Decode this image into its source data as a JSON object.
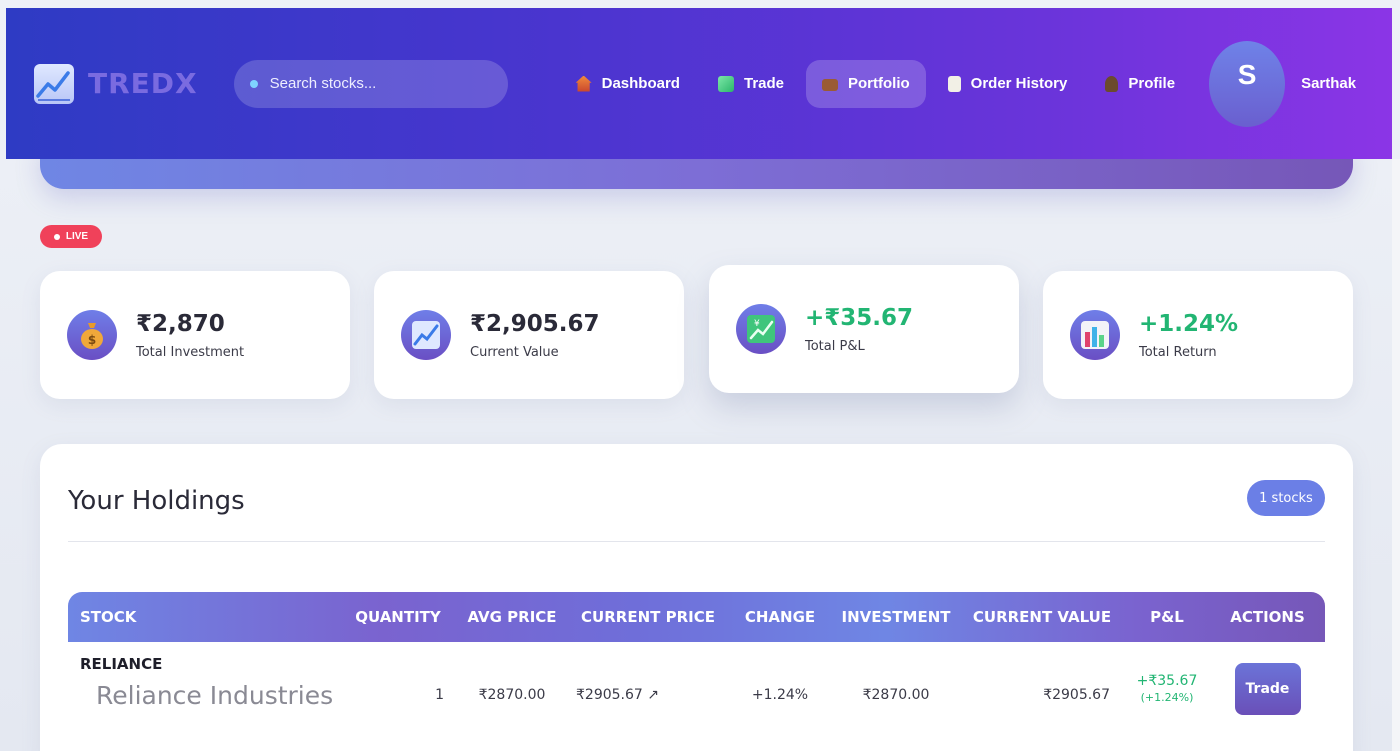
{
  "brand": {
    "name": "TREDX",
    "logo_icon": "chart-trend-icon"
  },
  "search": {
    "placeholder": "Search stocks..."
  },
  "nav": {
    "items": [
      {
        "label": "Dashboard",
        "icon": "house-icon",
        "active": false
      },
      {
        "label": "Trade",
        "icon": "chart-icon",
        "active": false
      },
      {
        "label": "Portfolio",
        "icon": "briefcase-icon",
        "active": true
      },
      {
        "label": "Order History",
        "icon": "clipboard-icon",
        "active": false
      },
      {
        "label": "Profile",
        "icon": "person-icon",
        "active": false
      }
    ]
  },
  "user": {
    "initial": "S",
    "name": "Sarthak"
  },
  "live_badge": "LIVE",
  "stats": [
    {
      "value": "₹2,870",
      "label": "Total Investment",
      "icon": "money-bag-icon",
      "positive": false
    },
    {
      "value": "₹2,905.67",
      "label": "Current Value",
      "icon": "trend-chart-icon",
      "positive": false
    },
    {
      "value": "+₹35.67",
      "label": "Total P&L",
      "icon": "yen-chart-icon",
      "positive": true
    },
    {
      "value": "+1.24%",
      "label": "Total Return",
      "icon": "bar-chart-icon",
      "positive": true
    }
  ],
  "holdings": {
    "title": "Your Holdings",
    "count_badge": "1 stocks",
    "columns": [
      "STOCK",
      "QUANTITY",
      "AVG PRICE",
      "CURRENT PRICE",
      "CHANGE",
      "INVESTMENT",
      "CURRENT VALUE",
      "P&L",
      "ACTIONS"
    ],
    "rows": [
      {
        "symbol": "RELIANCE",
        "company": "Reliance Industries",
        "quantity": "1",
        "avg_price": "₹2870.00",
        "current_price": "₹2905.67 ↗",
        "change": "+1.24%",
        "investment": "₹2870.00",
        "current_value": "₹2905.67",
        "pl": "+₹35.67",
        "pl_percent": "(+1.24%)",
        "action_label": "Trade"
      }
    ]
  },
  "colors": {
    "nav_start": "#2e3bc4",
    "nav_end": "#8b35e6",
    "positive": "#22b573",
    "live": "#f0415a",
    "accent": "#6b7fe6"
  }
}
